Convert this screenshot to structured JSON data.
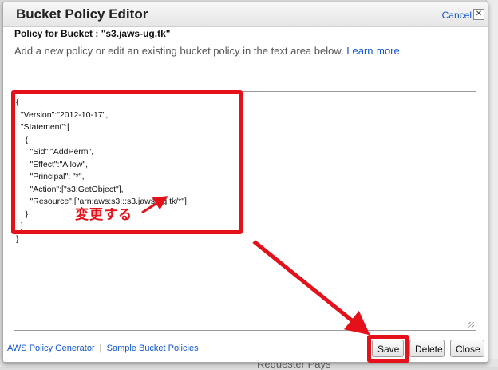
{
  "dialog": {
    "title": "Bucket Policy Editor",
    "cancel_label": "Cancel",
    "close_glyph": "✕"
  },
  "policy_label": "Policy for Bucket : \"s3.jaws-ug.tk\"",
  "instructions": {
    "text": "Add a new policy or edit an existing bucket policy in the text area below.",
    "link": "Learn more."
  },
  "policy_text": "{\n  \"Version\":\"2012-10-17\",\n  \"Statement\":[\n    {\n      \"Sid\":\"AddPerm\",\n      \"Effect\":\"Allow\",\n      \"Principal\": \"*\",\n      \"Action\":[\"s3:GetObject\"],\n      \"Resource\":[\"arn:aws:s3:::s3.jaws-ug.tk/*\"]\n    }\n  ]\n}",
  "annotation": {
    "text": "変更する",
    "color": "#e4111b"
  },
  "footer": {
    "link_generator": "AWS Policy Generator",
    "separator": "|",
    "link_samples": "Sample Bucket Policies",
    "save_label": "Save",
    "delete_label": "Delete",
    "close_label": "Close"
  },
  "background": {
    "partial_text": "Requester Pays"
  }
}
